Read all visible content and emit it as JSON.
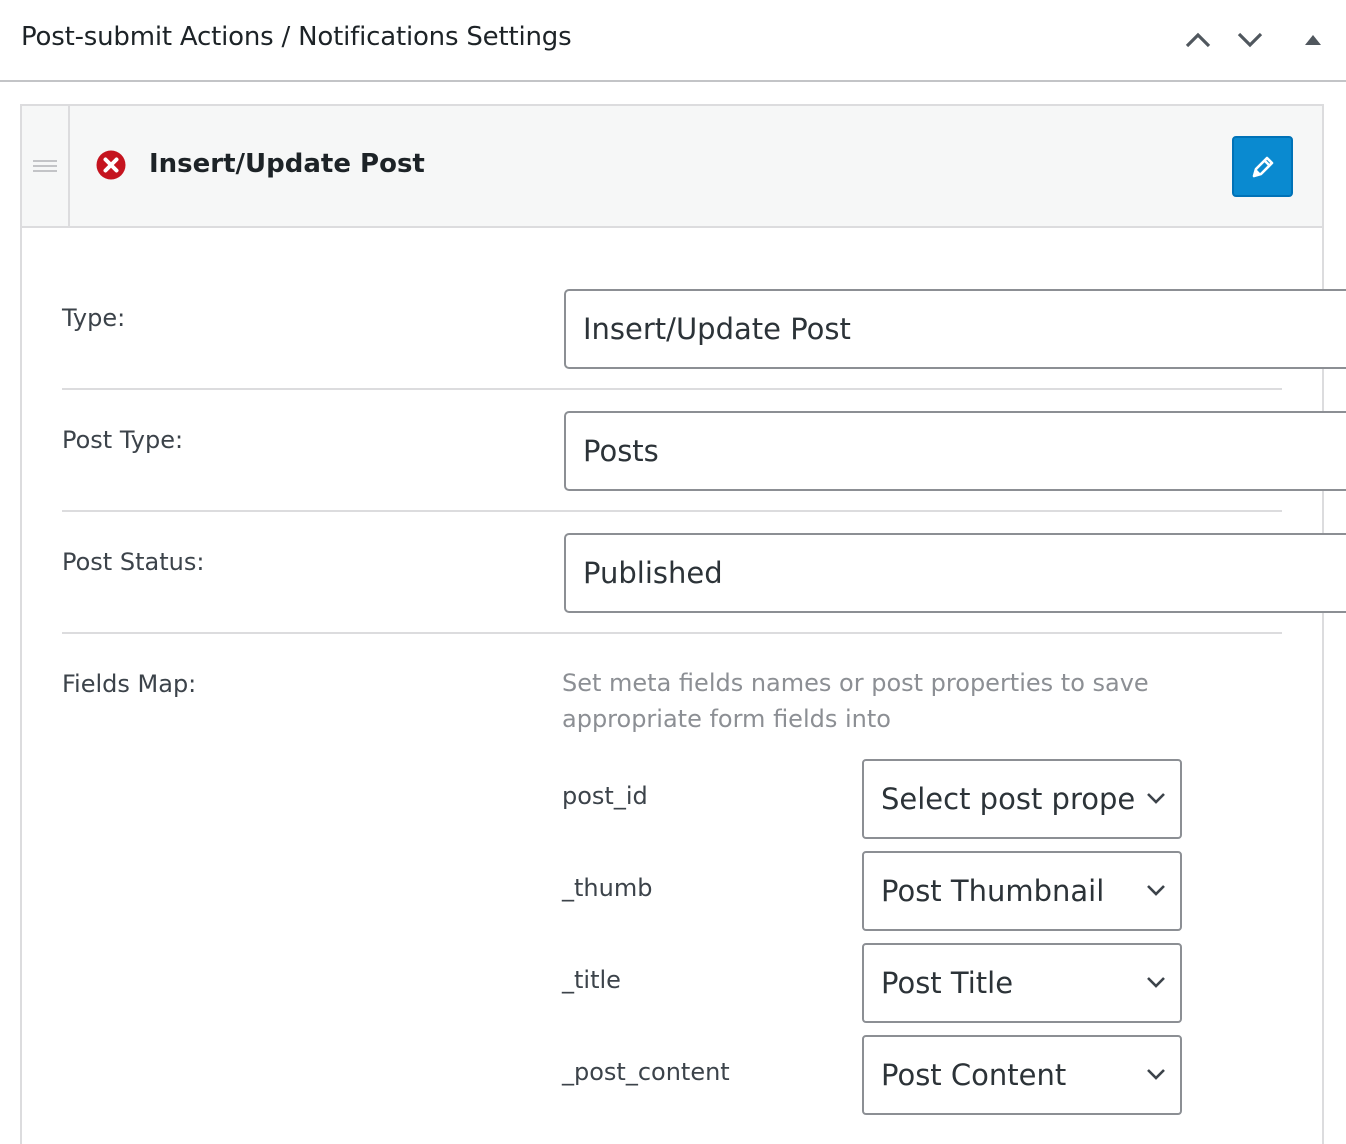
{
  "metabox": {
    "title": "Post-submit Actions / Notifications Settings",
    "controls": {
      "move_up_icon": "chevron-up-icon",
      "move_down_icon": "chevron-down-icon",
      "toggle_icon": "triangle-up-icon"
    }
  },
  "action": {
    "title": "Insert/Update Post",
    "status_icon": "error-icon",
    "edit_icon": "pencil-icon",
    "drag_icon": "drag-handle-icon"
  },
  "fields": {
    "type": {
      "label": "Type:",
      "value": "Insert/Update Post"
    },
    "post_type": {
      "label": "Post Type:",
      "value": "Posts"
    },
    "post_status": {
      "label": "Post Status:",
      "value": "Published"
    }
  },
  "fields_map": {
    "label": "Fields Map:",
    "description": "Set meta fields names or post properties to save appropriate form fields into",
    "rows": [
      {
        "field": "post_id",
        "value": "Select post property"
      },
      {
        "field": "_thumb",
        "value": "Post Thumbnail"
      },
      {
        "field": "_title",
        "value": "Post Title"
      },
      {
        "field": "_post_content",
        "value": "Post Content"
      }
    ]
  },
  "colors": {
    "accent": "#0a8ad0",
    "error": "#c5141f",
    "border": "#dcdcde",
    "input_border": "#8c8f94",
    "header_bg": "#f6f7f7"
  }
}
